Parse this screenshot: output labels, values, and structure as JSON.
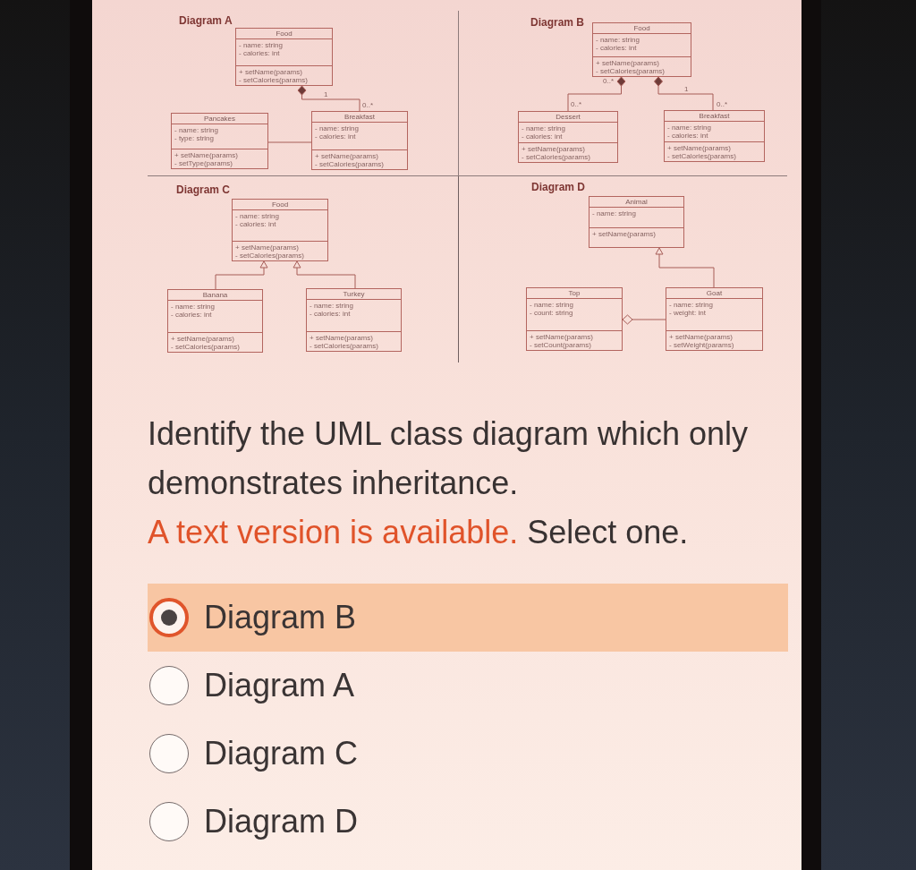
{
  "diagrams": [
    {
      "title": "Diagram A",
      "classes": [
        {
          "name": "Food",
          "attributes": [
            "- name: string",
            "- calories: int"
          ],
          "methods": [
            "+ setName(params)",
            "- setCalories(params)"
          ]
        },
        {
          "name": "Pancakes",
          "attributes": [
            "- name: string",
            "- type: string"
          ],
          "methods": [
            "+ setName(params)",
            "- setType(params)"
          ]
        },
        {
          "name": "Breakfast",
          "attributes": [
            "- name: string",
            "- calories: int"
          ],
          "methods": [
            "+ setName(params)",
            "- setCalories(params)"
          ]
        }
      ],
      "relations": [
        {
          "kind": "composition",
          "labels": [
            "1",
            "0..*"
          ]
        },
        {
          "kind": "association"
        }
      ]
    },
    {
      "title": "Diagram B",
      "classes": [
        {
          "name": "Food",
          "attributes": [
            "- name: string",
            "- calories: int"
          ],
          "methods": [
            "+ setName(params)",
            "- setCalories(params)"
          ]
        },
        {
          "name": "Dessert",
          "attributes": [
            "- name: string",
            "- calories: int"
          ],
          "methods": [
            "+ setName(params)",
            "- setCalories(params)"
          ]
        },
        {
          "name": "Breakfast",
          "attributes": [
            "- name: string",
            "- calories: int"
          ],
          "methods": [
            "+ setName(params)",
            "- setCalories(params)"
          ]
        }
      ],
      "relations": [
        {
          "kind": "composition",
          "labels": [
            "0..*",
            "0..*"
          ]
        },
        {
          "kind": "composition",
          "labels": [
            "1",
            "0..*"
          ]
        }
      ]
    },
    {
      "title": "Diagram C",
      "classes": [
        {
          "name": "Food",
          "attributes": [
            "- name: string",
            "- calories: int"
          ],
          "methods": [
            "+ setName(params)",
            "- setCalories(params)"
          ]
        },
        {
          "name": "Banana",
          "attributes": [
            "- name: string",
            "- calories: int"
          ],
          "methods": [
            "+ setName(params)",
            "- setCalories(params)"
          ]
        },
        {
          "name": "Turkey",
          "attributes": [
            "- name: string",
            "- calories: int"
          ],
          "methods": [
            "+ setName(params)",
            "- setCalories(params)"
          ]
        }
      ],
      "relations": [
        {
          "kind": "inheritance"
        },
        {
          "kind": "inheritance"
        }
      ]
    },
    {
      "title": "Diagram D",
      "classes": [
        {
          "name": "Animal",
          "attributes": [
            "- name: string"
          ],
          "methods": [
            "+ setName(params)"
          ]
        },
        {
          "name": "Top",
          "attributes": [
            "- name: string",
            "- count: string"
          ],
          "methods": [
            "+ setName(params)",
            "- setCount(params)"
          ]
        },
        {
          "name": "Goat",
          "attributes": [
            "- name: string",
            "- weight: int"
          ],
          "methods": [
            "+ setName(params)",
            "- setWeight(params)"
          ]
        }
      ],
      "relations": [
        {
          "kind": "inheritance"
        },
        {
          "kind": "aggregation"
        }
      ]
    }
  ],
  "question": {
    "text_before": "Identify the UML class diagram which only demonstrates inheritance.",
    "link": "A text version is available.",
    "text_after": "Select one."
  },
  "options": [
    {
      "label": "Diagram B",
      "selected": true
    },
    {
      "label": "Diagram A",
      "selected": false
    },
    {
      "label": "Diagram C",
      "selected": false
    },
    {
      "label": "Diagram D",
      "selected": false
    }
  ]
}
